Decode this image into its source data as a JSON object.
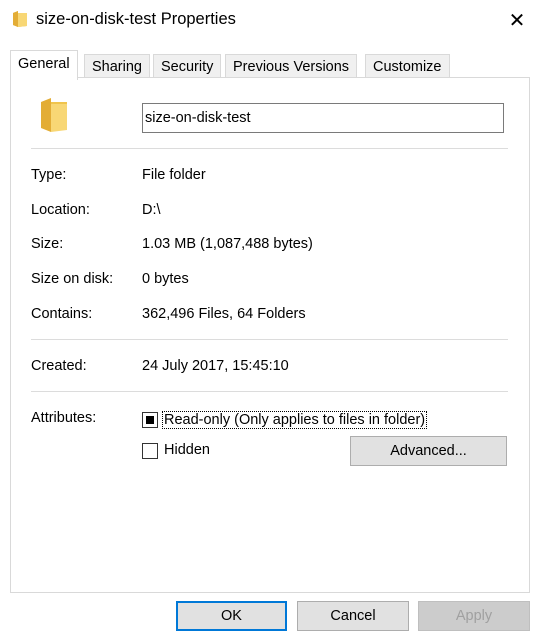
{
  "window": {
    "title": "size-on-disk-test Properties",
    "close_symbol": "✕"
  },
  "tabs": [
    {
      "label": "General"
    },
    {
      "label": "Sharing"
    },
    {
      "label": "Security"
    },
    {
      "label": "Previous Versions"
    },
    {
      "label": "Customize"
    }
  ],
  "general": {
    "name_value": "size-on-disk-test",
    "rows": [
      {
        "label": "Type:",
        "value": "File folder"
      },
      {
        "label": "Location:",
        "value": "D:\\"
      },
      {
        "label": "Size:",
        "value": "1.03 MB (1,087,488 bytes)"
      },
      {
        "label": "Size on disk:",
        "value": "0 bytes"
      },
      {
        "label": "Contains:",
        "value": "362,496 Files, 64 Folders"
      }
    ],
    "created": {
      "label": "Created:",
      "value": "24 July 2017, 15:45:10"
    },
    "attributes": {
      "label": "Attributes:",
      "readonly_label": "Read-only (Only applies to files in folder)",
      "readonly_state": "indeterminate",
      "hidden_label": "Hidden",
      "hidden_state": "unchecked",
      "advanced_label": "Advanced..."
    }
  },
  "buttons": {
    "ok": "OK",
    "cancel": "Cancel",
    "apply": "Apply"
  },
  "colors": {
    "folder": "#f8d775",
    "folder_dark": "#e8b84a",
    "focus_blue": "#0078d7"
  },
  "icons": {
    "title_icon": "folder-icon",
    "big_icon": "folder-icon",
    "close": "close-icon"
  }
}
